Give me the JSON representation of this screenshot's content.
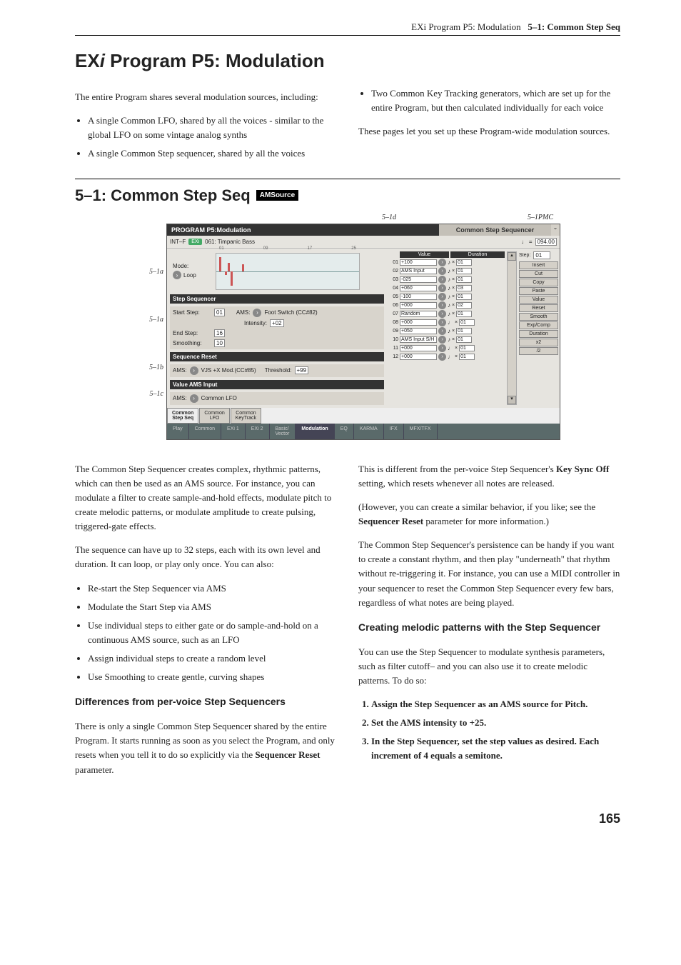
{
  "header": {
    "left": "EXi Program P5: Modulation",
    "right": "5–1: Common Step Seq"
  },
  "h1": "EXi Program P5: Modulation",
  "intro": {
    "l1": "The entire Program shares several modulation sources, including:",
    "b1": "A single Common LFO, shared by all the voices - similar to the global LFO on some vintage analog synths",
    "b2": "A single Common Step sequencer, shared by all the voices",
    "b3": "Two Common Key Tracking generators, which are set up for the entire Program, but then calculated individually for each voice",
    "r1": "These pages let you set up these Program-wide modulation sources."
  },
  "h2": "5–1: Common Step Seq",
  "ams_badge": "AMSource",
  "diagram_labels": {
    "top_left": "5–1d",
    "top_right": "5–1PMC",
    "l1": "5–1a",
    "l2": "5–1a",
    "l3": "5–1b",
    "l4": "5–1c"
  },
  "screen": {
    "title_l": "PROGRAM P5:Modulation",
    "title_r": "Common Step Sequencer",
    "menu": "⌄",
    "prog_pre": "INT–F",
    "prog_chip": "EXi",
    "prog_name": "061: Timpanic Bass",
    "tempo_l": "♩ =",
    "tempo_v": "094.00",
    "mode_lbl": "Mode:",
    "mode_val": "Loop",
    "graph_ticks": [
      "01",
      "09",
      "17",
      "25"
    ],
    "seq_hdr": "Step Sequencer",
    "start_lbl": "Start Step:",
    "start_val": "01",
    "start_ams_lbl": "AMS:",
    "start_ams": "Foot Switch (CC#82)",
    "int_lbl": "Intensity:",
    "int_val": "+02",
    "end_lbl": "End Step:",
    "end_val": "16",
    "smooth_lbl": "Smoothing:",
    "smooth_val": "10",
    "reset_hdr": "Sequence Reset",
    "reset_ams_lbl": "AMS:",
    "reset_ams": "VJS +X Mod.(CC#85)",
    "thresh_lbl": "Threshold:",
    "thresh_val": "+99",
    "vai_hdr": "Value AMS Input",
    "vai_lbl": "AMS:",
    "vai_val": "Common LFO",
    "val_hdr": "Value",
    "dur_hdr": "Duration",
    "steps": [
      {
        "n": "01",
        "v": "+100",
        "note": "♪",
        "d": "01"
      },
      {
        "n": "02",
        "v": "AMS Input",
        "note": "♪",
        "d": "01"
      },
      {
        "n": "03",
        "v": "-025",
        "note": "♪",
        "d": "01"
      },
      {
        "n": "04",
        "v": "+060",
        "note": "♪",
        "d": "03"
      },
      {
        "n": "05",
        "v": "-100",
        "note": "♪",
        "d": "01"
      },
      {
        "n": "06",
        "v": "+000",
        "note": "♪",
        "d": "02"
      },
      {
        "n": "07",
        "v": "Random",
        "note": "♪",
        "d": "01"
      },
      {
        "n": "08",
        "v": "+000",
        "note": "♩",
        "d": "01"
      },
      {
        "n": "09",
        "v": "+050",
        "note": "♪",
        "d": "01"
      },
      {
        "n": "10",
        "v": "AMS Input S/H",
        "note": "♪",
        "d": "01"
      },
      {
        "n": "11",
        "v": "+000",
        "note": "♩",
        "d": "01"
      },
      {
        "n": "12",
        "v": "+000",
        "note": "♩",
        "d": "01"
      }
    ],
    "side": {
      "step_lbl": "Step:",
      "step_v": "01",
      "btns": [
        "Insert",
        "Cut",
        "Copy",
        "Paste",
        "Value",
        "Reset",
        "Smooth",
        "Exp/Comp",
        "Duration",
        "x2",
        "/2"
      ]
    },
    "page_tabs": [
      "Common\nStep Seq",
      "Common\nLFO",
      "Common\nKeyTrack"
    ],
    "bottom_tabs": [
      "Play",
      "Common",
      "EXi 1",
      "EXi 2",
      "Basic/\nVector",
      "Modulation",
      "EQ",
      "KARMA",
      "IFX",
      "MFX/TFX"
    ],
    "tab_active": 5
  },
  "body": {
    "l1": "The Common Step Sequencer creates complex, rhythmic patterns, which can then be used as an AMS source. For instance, you can modulate a filter to create sample-and-hold effects, modulate pitch to create melodic patterns, or modulate amplitude to create pulsing, triggered-gate effects.",
    "l2": "The sequence can have up to 32 steps, each with its own level and duration. It can loop, or play only once. You can also:",
    "lb": [
      "Re-start the Step Sequencer via AMS",
      "Modulate the Start Step via AMS",
      "Use individual steps to either gate or do sample-and-hold on a continuous AMS source, such as an LFO",
      "Assign individual steps to create a random level",
      "Use Smoothing to create gentle, curving shapes"
    ],
    "lh3": "Differences from per-voice Step Sequencers",
    "l3a": "There is only a single Common Step Sequencer shared by the entire Program. It starts running as soon as you select the Program, and only resets when you tell it to do so explicitly via the ",
    "l3b": "Sequencer Reset",
    "l3c": " parameter.",
    "r1a": "This is different from the per-voice Step Sequencer's ",
    "r1b": "Key Sync Off",
    "r1c": " setting, which resets whenever all notes are released.",
    "r2a": "(However, you can create a similar behavior, if you like; see the ",
    "r2b": "Sequencer Reset",
    "r2c": " parameter for more information.)",
    "r3": "The Common Step Sequencer's persistence can be handy if you want to create a constant rhythm, and then play \"underneath\" that rhythm without re-triggering it. For instance, you can use a MIDI controller in your sequencer to reset the Common Step Sequencer every few bars, regardless of what notes are being played.",
    "rh3": "Creating melodic patterns with the Step Sequencer",
    "r4": "You can use the Step Sequencer to modulate synthesis parameters, such as filter cutoff– and you can also use it to create melodic patterns. To do so:",
    "rs": [
      "Assign the Step Sequencer as an AMS source for Pitch.",
      "Set the AMS intensity to +25.",
      "In the Step Sequencer, set the step values as desired. Each increment of 4 equals a semitone."
    ]
  },
  "chart_data": {
    "type": "bar",
    "categories": [
      "01",
      "02",
      "03",
      "04",
      "05",
      "06",
      "07",
      "08",
      "09",
      "10",
      "11",
      "12",
      "13",
      "14",
      "15",
      "16"
    ],
    "values": [
      100,
      0,
      -25,
      60,
      -100,
      0,
      0,
      0,
      50,
      0,
      0,
      0,
      0,
      0,
      0,
      0
    ],
    "ylim": [
      -100,
      100
    ],
    "title": "Step Sequencer Values"
  },
  "page_num": "165"
}
